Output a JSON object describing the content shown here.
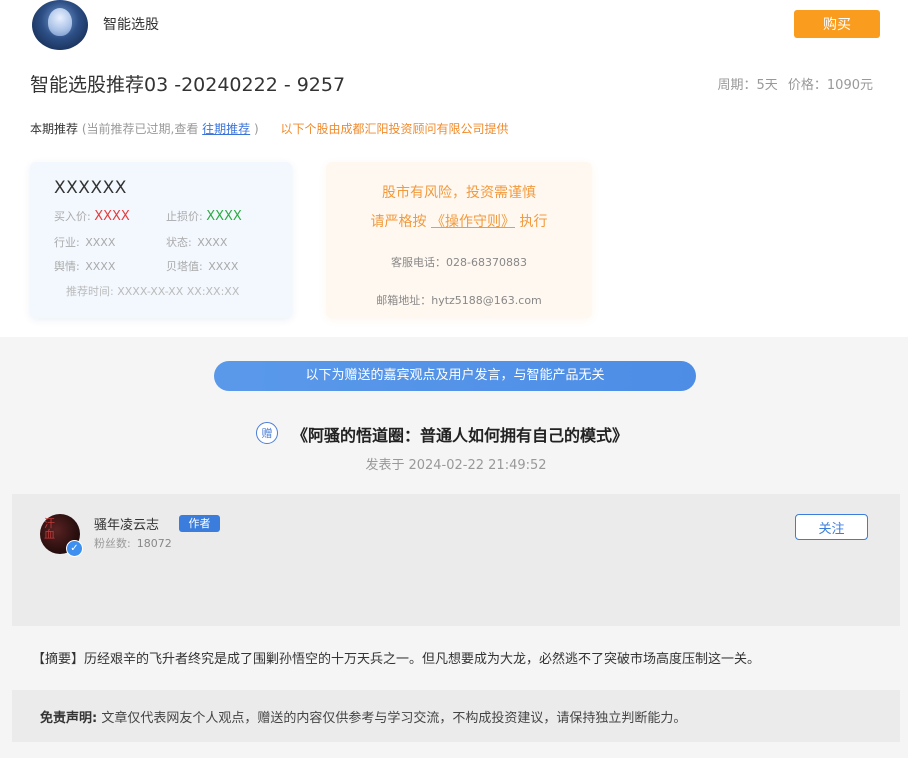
{
  "header": {
    "app_name": "智能选股",
    "buy_label": "购买"
  },
  "product": {
    "title": "智能选股推荐03 -20240222 - 9257",
    "period": "周期：5天",
    "price": "价格：1090元"
  },
  "recommendation": {
    "label": "本期推荐",
    "note": "(当前推荐已过期,查看",
    "past_link": "往期推荐",
    "note_end": ")",
    "provider": "以下个股由成都汇阳投资顾问有限公司提供"
  },
  "stock_card": {
    "name": "XXXXXX",
    "buy_price_label": "买入价:",
    "buy_price": "XXXX",
    "stop_loss_label": "止损价:",
    "stop_loss": "XXXX",
    "industry_label": "行业:",
    "industry": "XXXX",
    "status_label": "状态:",
    "status": "XXXX",
    "sentiment_label": "舆情:",
    "sentiment": "XXXX",
    "beta_label": "贝塔值:",
    "beta": "XXXX",
    "time_label": "推荐时间:",
    "time": "XXXX-XX-XX XX:XX:XX"
  },
  "risk_card": {
    "warning": "股市有风险，投资需谨慎",
    "follow_prefix": "请严格按",
    "guide_link": "《操作守则》",
    "follow_suffix": "执行",
    "phone": "客服电话：028-68370883",
    "email": "邮箱地址：hytz5188@163.com"
  },
  "banner": {
    "text": "以下为赠送的嘉宾观点及用户发言，与智能产品无关"
  },
  "article": {
    "gift_icon_text": "赠",
    "title": "《阿骚的悟道圈：普通人如何拥有自己的模式》",
    "published_label": "发表于",
    "published_time": "2024-02-22 21:49:52"
  },
  "author": {
    "name": "骚年凌云志",
    "badge": "作者",
    "fans_label": "粉丝数:",
    "fans_count": "18072",
    "follow_label": "关注"
  },
  "summary": {
    "text": "【摘要】历经艰辛的飞升者终究是成了围剿孙悟空的十万天兵之一。但凡想要成为大龙，必然逃不了突破市场高度压制这一关。"
  },
  "disclaimer": {
    "label": "免责声明:",
    "text": "文章仅代表网友个人观点，赠送的内容仅供参考与学习交流，不构成投资建议，请保持独立判断能力。"
  }
}
